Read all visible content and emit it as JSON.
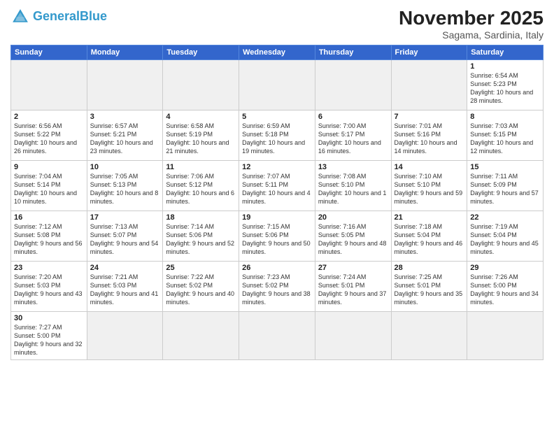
{
  "header": {
    "logo_general": "General",
    "logo_blue": "Blue",
    "month_title": "November 2025",
    "subtitle": "Sagama, Sardinia, Italy"
  },
  "days_of_week": [
    "Sunday",
    "Monday",
    "Tuesday",
    "Wednesday",
    "Thursday",
    "Friday",
    "Saturday"
  ],
  "weeks": [
    [
      {
        "day": "",
        "empty": true
      },
      {
        "day": "",
        "empty": true
      },
      {
        "day": "",
        "empty": true
      },
      {
        "day": "",
        "empty": true
      },
      {
        "day": "",
        "empty": true
      },
      {
        "day": "",
        "empty": true
      },
      {
        "day": "1",
        "sunrise": "Sunrise: 6:54 AM",
        "sunset": "Sunset: 5:23 PM",
        "daylight": "Daylight: 10 hours and 28 minutes."
      }
    ],
    [
      {
        "day": "2",
        "sunrise": "Sunrise: 6:56 AM",
        "sunset": "Sunset: 5:22 PM",
        "daylight": "Daylight: 10 hours and 26 minutes."
      },
      {
        "day": "3",
        "sunrise": "Sunrise: 6:57 AM",
        "sunset": "Sunset: 5:21 PM",
        "daylight": "Daylight: 10 hours and 23 minutes."
      },
      {
        "day": "4",
        "sunrise": "Sunrise: 6:58 AM",
        "sunset": "Sunset: 5:19 PM",
        "daylight": "Daylight: 10 hours and 21 minutes."
      },
      {
        "day": "5",
        "sunrise": "Sunrise: 6:59 AM",
        "sunset": "Sunset: 5:18 PM",
        "daylight": "Daylight: 10 hours and 19 minutes."
      },
      {
        "day": "6",
        "sunrise": "Sunrise: 7:00 AM",
        "sunset": "Sunset: 5:17 PM",
        "daylight": "Daylight: 10 hours and 16 minutes."
      },
      {
        "day": "7",
        "sunrise": "Sunrise: 7:01 AM",
        "sunset": "Sunset: 5:16 PM",
        "daylight": "Daylight: 10 hours and 14 minutes."
      },
      {
        "day": "8",
        "sunrise": "Sunrise: 7:03 AM",
        "sunset": "Sunset: 5:15 PM",
        "daylight": "Daylight: 10 hours and 12 minutes."
      }
    ],
    [
      {
        "day": "9",
        "sunrise": "Sunrise: 7:04 AM",
        "sunset": "Sunset: 5:14 PM",
        "daylight": "Daylight: 10 hours and 10 minutes."
      },
      {
        "day": "10",
        "sunrise": "Sunrise: 7:05 AM",
        "sunset": "Sunset: 5:13 PM",
        "daylight": "Daylight: 10 hours and 8 minutes."
      },
      {
        "day": "11",
        "sunrise": "Sunrise: 7:06 AM",
        "sunset": "Sunset: 5:12 PM",
        "daylight": "Daylight: 10 hours and 6 minutes."
      },
      {
        "day": "12",
        "sunrise": "Sunrise: 7:07 AM",
        "sunset": "Sunset: 5:11 PM",
        "daylight": "Daylight: 10 hours and 4 minutes."
      },
      {
        "day": "13",
        "sunrise": "Sunrise: 7:08 AM",
        "sunset": "Sunset: 5:10 PM",
        "daylight": "Daylight: 10 hours and 1 minute."
      },
      {
        "day": "14",
        "sunrise": "Sunrise: 7:10 AM",
        "sunset": "Sunset: 5:10 PM",
        "daylight": "Daylight: 9 hours and 59 minutes."
      },
      {
        "day": "15",
        "sunrise": "Sunrise: 7:11 AM",
        "sunset": "Sunset: 5:09 PM",
        "daylight": "Daylight: 9 hours and 57 minutes."
      }
    ],
    [
      {
        "day": "16",
        "sunrise": "Sunrise: 7:12 AM",
        "sunset": "Sunset: 5:08 PM",
        "daylight": "Daylight: 9 hours and 56 minutes."
      },
      {
        "day": "17",
        "sunrise": "Sunrise: 7:13 AM",
        "sunset": "Sunset: 5:07 PM",
        "daylight": "Daylight: 9 hours and 54 minutes."
      },
      {
        "day": "18",
        "sunrise": "Sunrise: 7:14 AM",
        "sunset": "Sunset: 5:06 PM",
        "daylight": "Daylight: 9 hours and 52 minutes."
      },
      {
        "day": "19",
        "sunrise": "Sunrise: 7:15 AM",
        "sunset": "Sunset: 5:06 PM",
        "daylight": "Daylight: 9 hours and 50 minutes."
      },
      {
        "day": "20",
        "sunrise": "Sunrise: 7:16 AM",
        "sunset": "Sunset: 5:05 PM",
        "daylight": "Daylight: 9 hours and 48 minutes."
      },
      {
        "day": "21",
        "sunrise": "Sunrise: 7:18 AM",
        "sunset": "Sunset: 5:04 PM",
        "daylight": "Daylight: 9 hours and 46 minutes."
      },
      {
        "day": "22",
        "sunrise": "Sunrise: 7:19 AM",
        "sunset": "Sunset: 5:04 PM",
        "daylight": "Daylight: 9 hours and 45 minutes."
      }
    ],
    [
      {
        "day": "23",
        "sunrise": "Sunrise: 7:20 AM",
        "sunset": "Sunset: 5:03 PM",
        "daylight": "Daylight: 9 hours and 43 minutes."
      },
      {
        "day": "24",
        "sunrise": "Sunrise: 7:21 AM",
        "sunset": "Sunset: 5:03 PM",
        "daylight": "Daylight: 9 hours and 41 minutes."
      },
      {
        "day": "25",
        "sunrise": "Sunrise: 7:22 AM",
        "sunset": "Sunset: 5:02 PM",
        "daylight": "Daylight: 9 hours and 40 minutes."
      },
      {
        "day": "26",
        "sunrise": "Sunrise: 7:23 AM",
        "sunset": "Sunset: 5:02 PM",
        "daylight": "Daylight: 9 hours and 38 minutes."
      },
      {
        "day": "27",
        "sunrise": "Sunrise: 7:24 AM",
        "sunset": "Sunset: 5:01 PM",
        "daylight": "Daylight: 9 hours and 37 minutes."
      },
      {
        "day": "28",
        "sunrise": "Sunrise: 7:25 AM",
        "sunset": "Sunset: 5:01 PM",
        "daylight": "Daylight: 9 hours and 35 minutes."
      },
      {
        "day": "29",
        "sunrise": "Sunrise: 7:26 AM",
        "sunset": "Sunset: 5:00 PM",
        "daylight": "Daylight: 9 hours and 34 minutes."
      }
    ],
    [
      {
        "day": "30",
        "sunrise": "Sunrise: 7:27 AM",
        "sunset": "Sunset: 5:00 PM",
        "daylight": "Daylight: 9 hours and 32 minutes."
      },
      {
        "day": "",
        "empty": true
      },
      {
        "day": "",
        "empty": true
      },
      {
        "day": "",
        "empty": true
      },
      {
        "day": "",
        "empty": true
      },
      {
        "day": "",
        "empty": true
      },
      {
        "day": "",
        "empty": true
      }
    ]
  ]
}
